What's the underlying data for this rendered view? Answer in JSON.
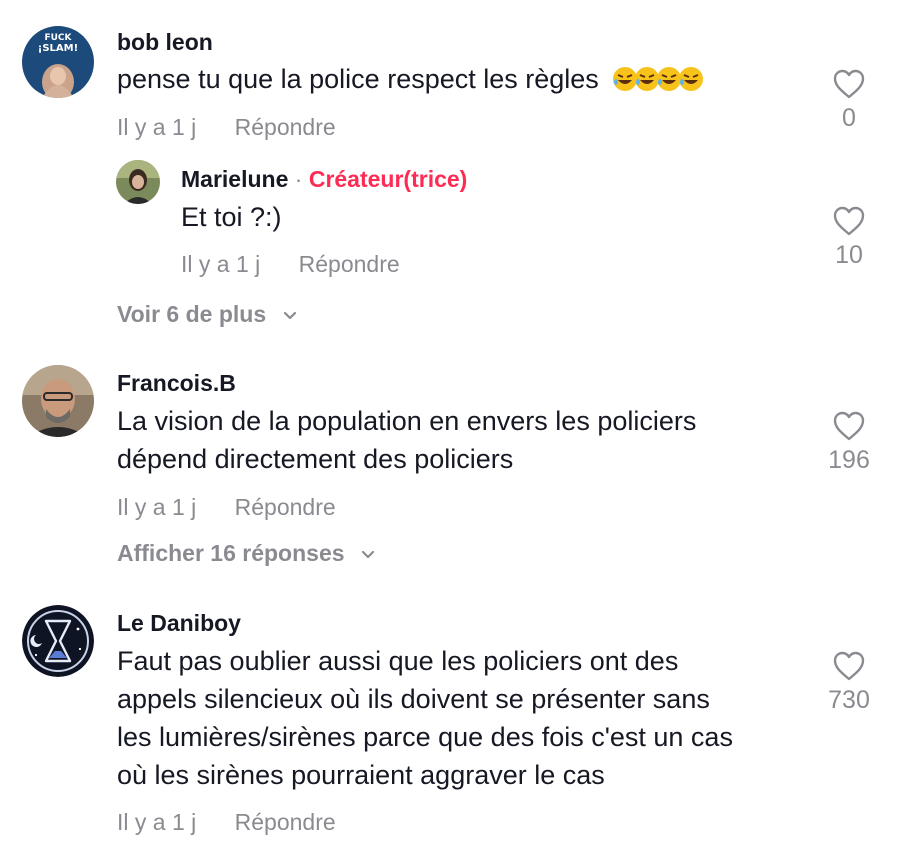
{
  "comments": [
    {
      "username": "bob leon",
      "avatar_text": "FUCK ¡SLAM!",
      "text": "pense tu que la police respect les règles",
      "emoji_count": 4,
      "emoji_name": "rolling-on-the-floor-laughing",
      "time": "Il y a 1 j",
      "reply_label": "Répondre",
      "likes": "0",
      "replies": [
        {
          "username": "Marielune",
          "separator": "·",
          "creator_label": "Créateur(trice)",
          "text": "Et toi ?:)",
          "time": "Il y a 1 j",
          "reply_label": "Répondre",
          "likes": "10"
        }
      ],
      "expander": "Voir 6 de plus"
    },
    {
      "username": "Francois.B",
      "text_lines": [
        "La vision de la population en envers les policiers",
        "dépend directement des policiers"
      ],
      "time": "Il y a 1 j",
      "reply_label": "Répondre",
      "likes": "196",
      "expander": "Afficher 16 réponses"
    },
    {
      "username": "Le Daniboy",
      "text_lines": [
        "Faut pas oublier aussi que les policiers ont des",
        "appels silencieux où ils doivent se présenter sans",
        "les lumières/sirènes parce que des fois c'est un cas",
        "où les sirènes pourraient aggraver le cas"
      ],
      "time": "Il y a 1 j",
      "reply_label": "Répondre",
      "likes": "730"
    }
  ],
  "colors": {
    "text_primary": "#161823",
    "text_secondary": "#8a8b91",
    "creator_accent": "#fe2c55",
    "background": "#ffffff"
  },
  "icons": {
    "like": "heart-outline-icon",
    "expand": "chevron-down-icon"
  }
}
